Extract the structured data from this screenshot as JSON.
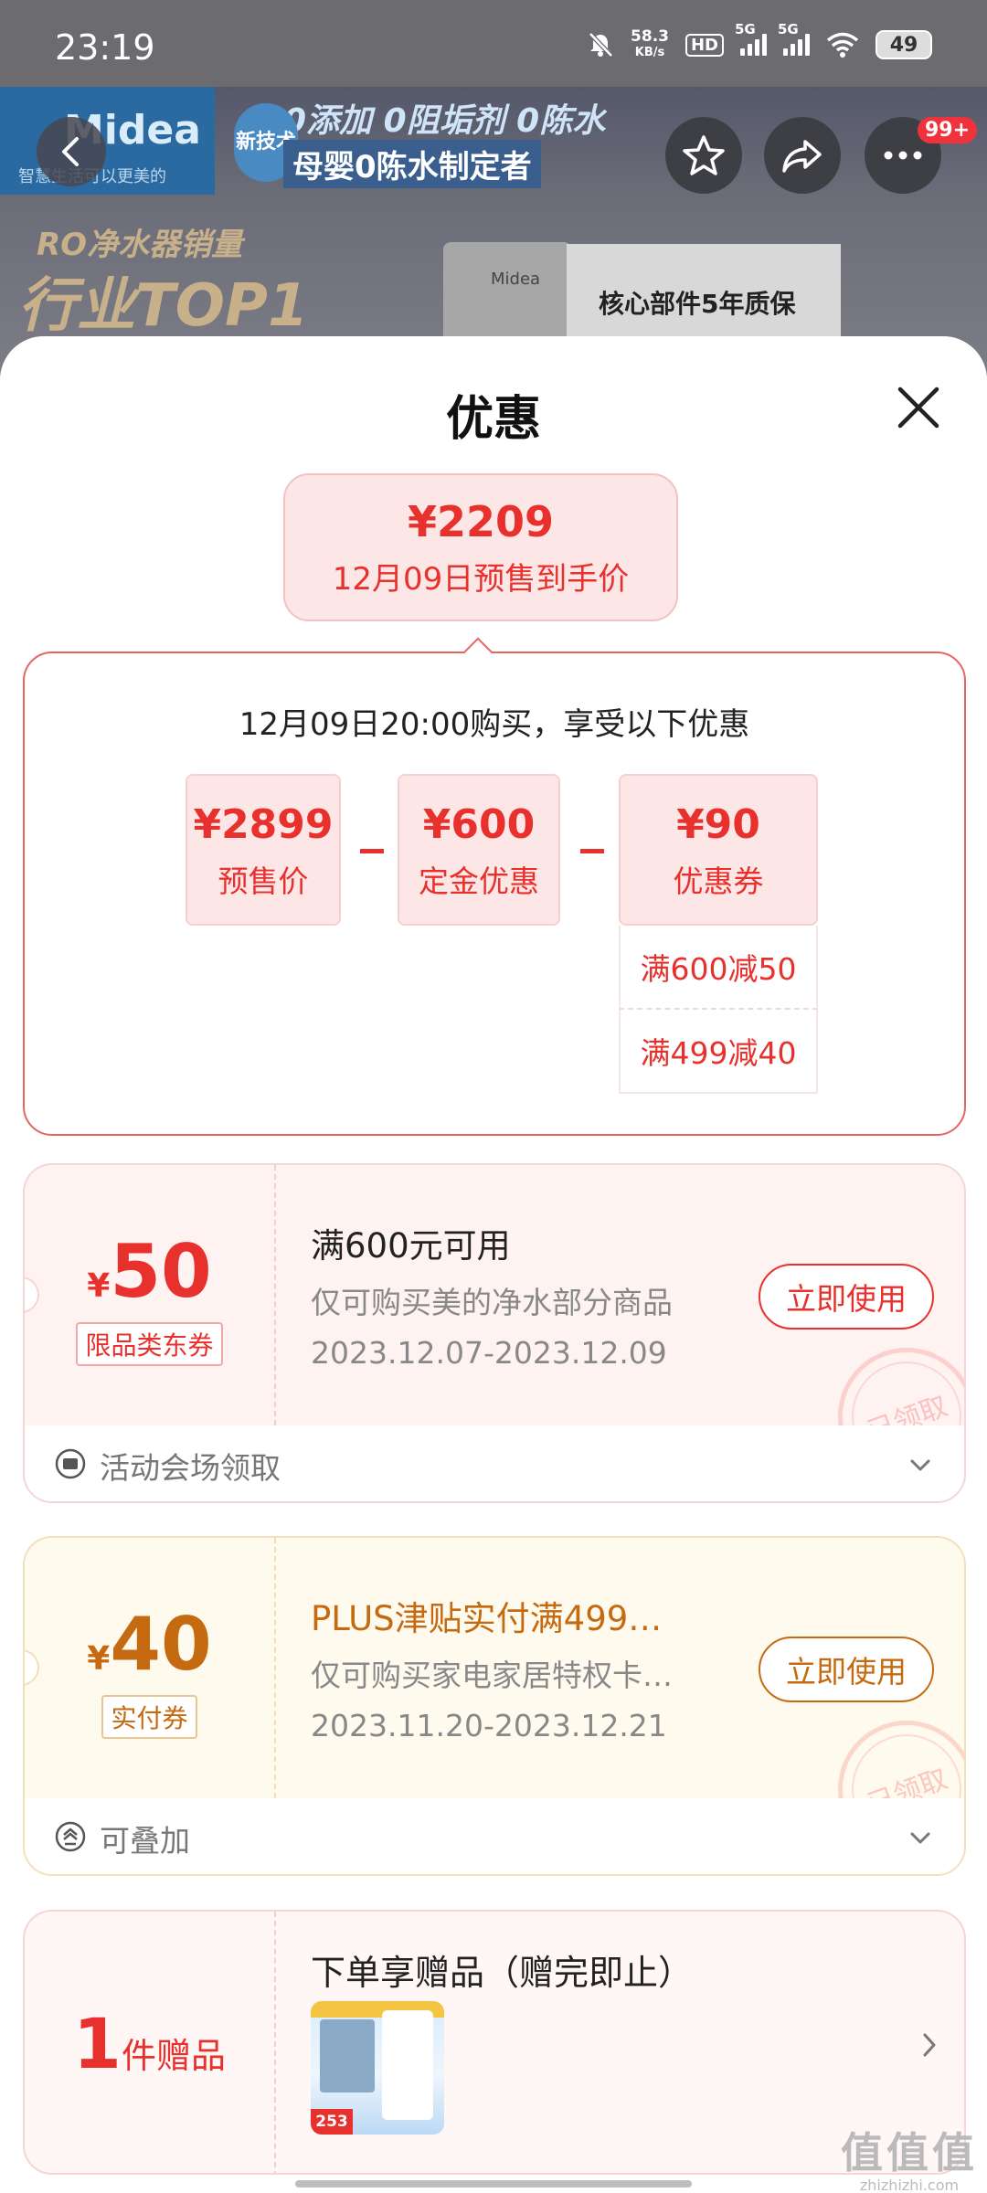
{
  "status_bar": {
    "time": "23:19",
    "net_speed_value": "58.3",
    "net_speed_unit": "KB/s",
    "hd_label": "HD",
    "signal1_label": "5G",
    "signal2_label": "5G",
    "battery": "49"
  },
  "banner": {
    "brand_logo": "Midea",
    "brand_slogan": "智慧生活可以更美的",
    "newtech_badge": "新技术",
    "headline1": "0添加 0阻垢剂 0陈水",
    "headline2": "母婴0陈水制定者",
    "promo_small": "RO净水器销量",
    "promo_big": "行业TOP1",
    "device_logo": "Midea",
    "device_text": "核心部件5年质保",
    "more_badge": "99+"
  },
  "sheet": {
    "title": "优惠"
  },
  "final_price": {
    "amount": "¥2209",
    "label": "12月09日预售到手价"
  },
  "calc": {
    "title": "12月09日20:00购买，享受以下优惠",
    "items": [
      {
        "value": "¥2899",
        "label": "预售价"
      },
      {
        "value": "¥600",
        "label": "定金优惠"
      },
      {
        "value": "¥90",
        "label": "优惠券"
      }
    ],
    "coupon_details": [
      "满600减50",
      "满499减40"
    ]
  },
  "coupons": [
    {
      "currency": "¥",
      "amount": "50",
      "tag": "限品类东券",
      "title": "满600元可用",
      "desc": "仅可购买美的净水部分商品",
      "validity": "2023.12.07-2023.12.09",
      "button": "立即使用",
      "stamp": "已领取",
      "footer": "活动会场领取"
    },
    {
      "currency": "¥",
      "amount": "40",
      "tag": "实付券",
      "title": "PLUS津贴实付满499…",
      "desc": "仅可购买家电家居特权卡…",
      "validity": "2023.11.20-2023.12.21",
      "button": "立即使用",
      "stamp": "已领取",
      "footer": "可叠加"
    }
  ],
  "gift": {
    "count": "1",
    "unit": "件赠品",
    "title": "下单享赠品（赠完即止）",
    "thumb_price": "253"
  },
  "watermark": {
    "main": "值值值",
    "sub": "zhizhizhi.com"
  },
  "colors": {
    "accent_red": "#e8302d",
    "accent_gold": "#c66a12",
    "pale_red": "#fde6e6"
  }
}
